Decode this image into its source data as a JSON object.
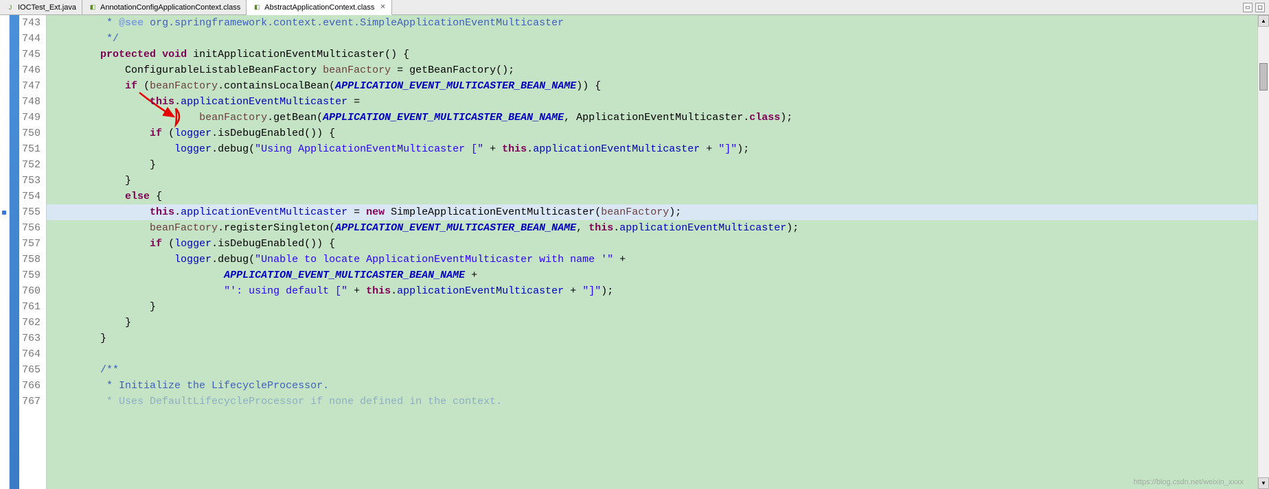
{
  "tabs": [
    {
      "label": "IOCTest_Ext.java",
      "icon": "J",
      "icon_color": "#5b8c2a",
      "active": false
    },
    {
      "label": "AnnotationConfigApplicationContext.class",
      "icon": "◧",
      "icon_color": "#5b8c2a",
      "active": false
    },
    {
      "label": "AbstractApplicationContext.class",
      "icon": "◧",
      "icon_color": "#5b8c2a",
      "active": true,
      "close": "✕"
    }
  ],
  "toolbar": {
    "min": "▭",
    "max": "▢"
  },
  "line_start": 743,
  "code_lines": [
    {
      "n": 743,
      "html": "         <span class='comment'>* <span class='doctag'>@see</span> org.springframework.context.event.SimpleApplicationEventMulticaster</span>"
    },
    {
      "n": 744,
      "html": "         <span class='comment'>*/</span>"
    },
    {
      "n": 745,
      "html": "        <span class='kw'>protected</span> <span class='kw'>void</span> initApplicationEventMulticaster() {"
    },
    {
      "n": 746,
      "html": "            ConfigurableListableBeanFactory <span class='param'>beanFactory</span> = getBeanFactory();"
    },
    {
      "n": 747,
      "html": "            <span class='kw'>if</span> (<span class='param'>beanFactory</span>.containsLocalBean(<span class='const'>APPLICATION_EVENT_MULTICASTER_BEAN_NAME</span>)) {"
    },
    {
      "n": 748,
      "html": "                <span class='kw'>this</span>.<span class='field'>applicationEventMulticaster</span> ="
    },
    {
      "n": 749,
      "html": "                        <span class='param'>beanFactory</span>.getBean(<span class='const'>APPLICATION_EVENT_MULTICASTER_BEAN_NAME</span>, ApplicationEventMulticaster.<span class='kw'>class</span>);"
    },
    {
      "n": 750,
      "html": "                <span class='kw'>if</span> (<span class='field'>logger</span>.isDebugEnabled()) {"
    },
    {
      "n": 751,
      "html": "                    <span class='field'>logger</span>.debug(<span class='str'>\"Using ApplicationEventMulticaster [\"</span> + <span class='kw'>this</span>.<span class='field'>applicationEventMulticaster</span> + <span class='str'>\"]\"</span>);"
    },
    {
      "n": 752,
      "html": "                }"
    },
    {
      "n": 753,
      "html": "            }"
    },
    {
      "n": 754,
      "html": "            <span class='kw'>else</span> {"
    },
    {
      "n": 755,
      "html": "                <span class='kw'>this</span>.<span class='field'>applicationEventMulticaster</span> = <span class='kw'>new</span> SimpleApplicationEventMulticaster(<span class='param'>beanFactory</span>);",
      "cursor": true,
      "hl": true
    },
    {
      "n": 756,
      "html": "                <span class='param'>beanFactory</span>.registerSingleton(<span class='const'>APPLICATION_EVENT_MULTICASTER_BEAN_NAME</span>, <span class='kw'>this</span>.<span class='field'>applicationEventMulticaster</span>);"
    },
    {
      "n": 757,
      "html": "                <span class='kw'>if</span> (<span class='field'>logger</span>.isDebugEnabled()) {"
    },
    {
      "n": 758,
      "html": "                    <span class='field'>logger</span>.debug(<span class='str'>\"Unable to locate ApplicationEventMulticaster with name '\"</span> +"
    },
    {
      "n": 759,
      "html": "                            <span class='const'>APPLICATION_EVENT_MULTICASTER_BEAN_NAME</span> +"
    },
    {
      "n": 760,
      "html": "                            <span class='str'>\"': using default [\"</span> + <span class='kw'>this</span>.<span class='field'>applicationEventMulticaster</span> + <span class='str'>\"]\"</span>);"
    },
    {
      "n": 761,
      "html": "                }"
    },
    {
      "n": 762,
      "html": "            }"
    },
    {
      "n": 763,
      "html": "        }"
    },
    {
      "n": 764,
      "html": ""
    },
    {
      "n": 765,
      "html": "        <span class='comment'>/**</span>"
    },
    {
      "n": 766,
      "html": "         <span class='comment'>* Initialize the LifecycleProcessor.</span>"
    },
    {
      "n": 767,
      "html": "         <span class='comment'>* Uses DefaultLifecycleProcessor if none defined in the context.</span>",
      "faded": true
    }
  ],
  "watermark": "https://blog.csdn.net/weixin_xxxx"
}
